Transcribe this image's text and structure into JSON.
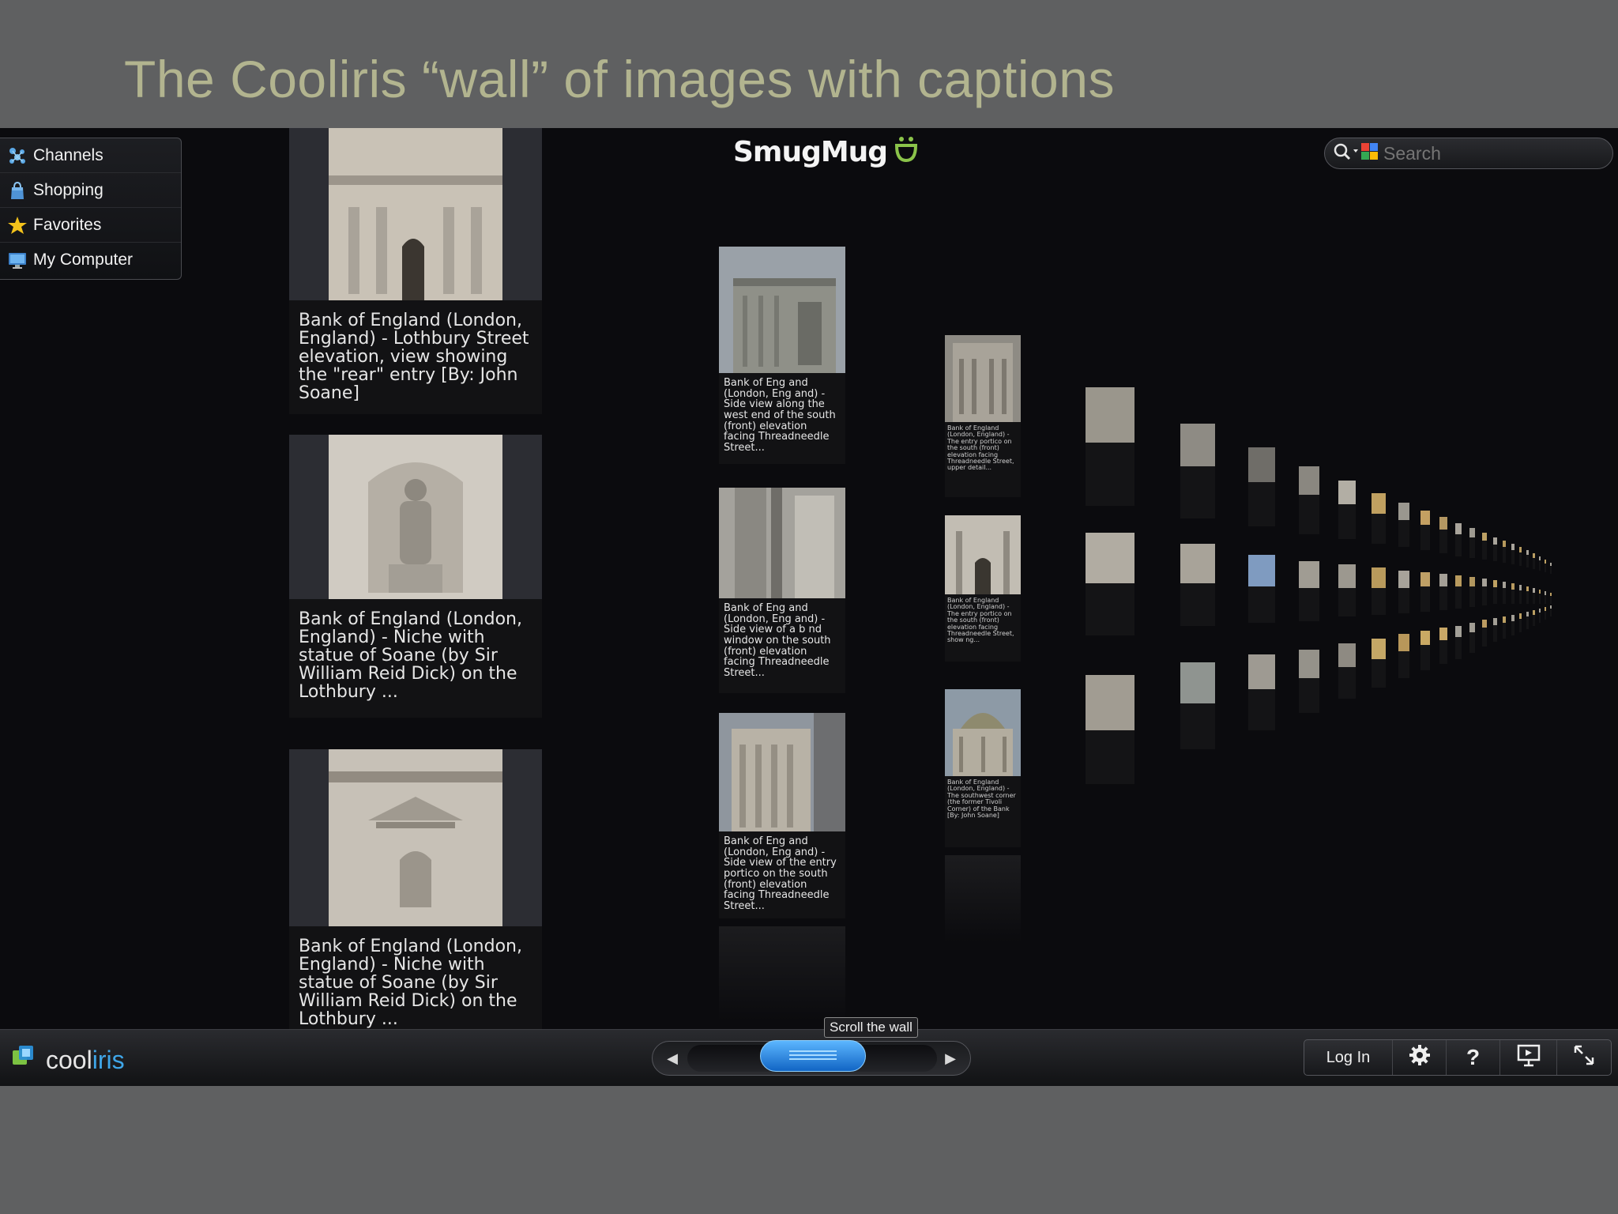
{
  "slide": {
    "title": "The Cooliris “wall” of images with captions"
  },
  "menu": {
    "items": [
      {
        "label": "Channels",
        "icon": "channels-icon"
      },
      {
        "label": "Shopping",
        "icon": "shopping-bag-icon"
      },
      {
        "label": "Favorites",
        "icon": "star-icon"
      },
      {
        "label": "My Computer",
        "icon": "computer-icon"
      }
    ]
  },
  "brand": {
    "name": "SmugMug",
    "icon": "smiley-icon"
  },
  "search": {
    "placeholder": "Search",
    "icon": "search-icon",
    "engine_icon": "google-icon"
  },
  "wall": {
    "col1": [
      {
        "caption": "Bank of England (London, England) - Lothbury Street elevation, view showing the \"rear\" entry [By: John Soane]"
      },
      {
        "caption": "Bank of England (London, England) - Niche with statue of Soane (by Sir William Reid Dick) on the Lothbury ..."
      },
      {
        "caption": "Bank of England (London, England) - Niche with statue of Soane (by Sir William Reid Dick) on the Lothbury ..."
      }
    ],
    "col2": [
      {
        "caption": "Bank of Eng and (London, Eng and) - Side view along the west end of the south (front) elevation facing Threadneedle Street..."
      },
      {
        "caption": "Bank of Eng and (London, Eng and) - Side view of a b nd window on the south (front) elevation facing Threadneedle Street..."
      },
      {
        "caption": "Bank of Eng and (London, Eng and) - Side view of the entry portico on the south (front) elevation facing Threadneedle Street..."
      }
    ],
    "col3": [
      {
        "caption": "Bank of England (London, England) - The entry portico on the south (front) elevation facing Threadneedle Street, upper detail..."
      },
      {
        "caption": "Bank of England (London, England) - The entry portico on the south (front) elevation facing Threadneedle Street, show ng..."
      },
      {
        "caption": "Bank of England (London, England) - The southwest corner (the former Tivoli Corner) of the Bank [By: John Soane]"
      }
    ]
  },
  "bottom_bar": {
    "logo_cool": "cool",
    "logo_iris": "iris",
    "scroll_tooltip": "Scroll the wall",
    "login_label": "Log In",
    "buttons": [
      {
        "name": "settings",
        "icon": "gear-icon"
      },
      {
        "name": "help",
        "icon": "question-icon",
        "label": "?"
      },
      {
        "name": "present",
        "icon": "present-icon"
      },
      {
        "name": "fullscreen",
        "icon": "fullscreen-icon"
      }
    ]
  },
  "colors": {
    "accent": "#3fa6e8",
    "title": "#b2b48f",
    "background": "#0b0b0e"
  }
}
